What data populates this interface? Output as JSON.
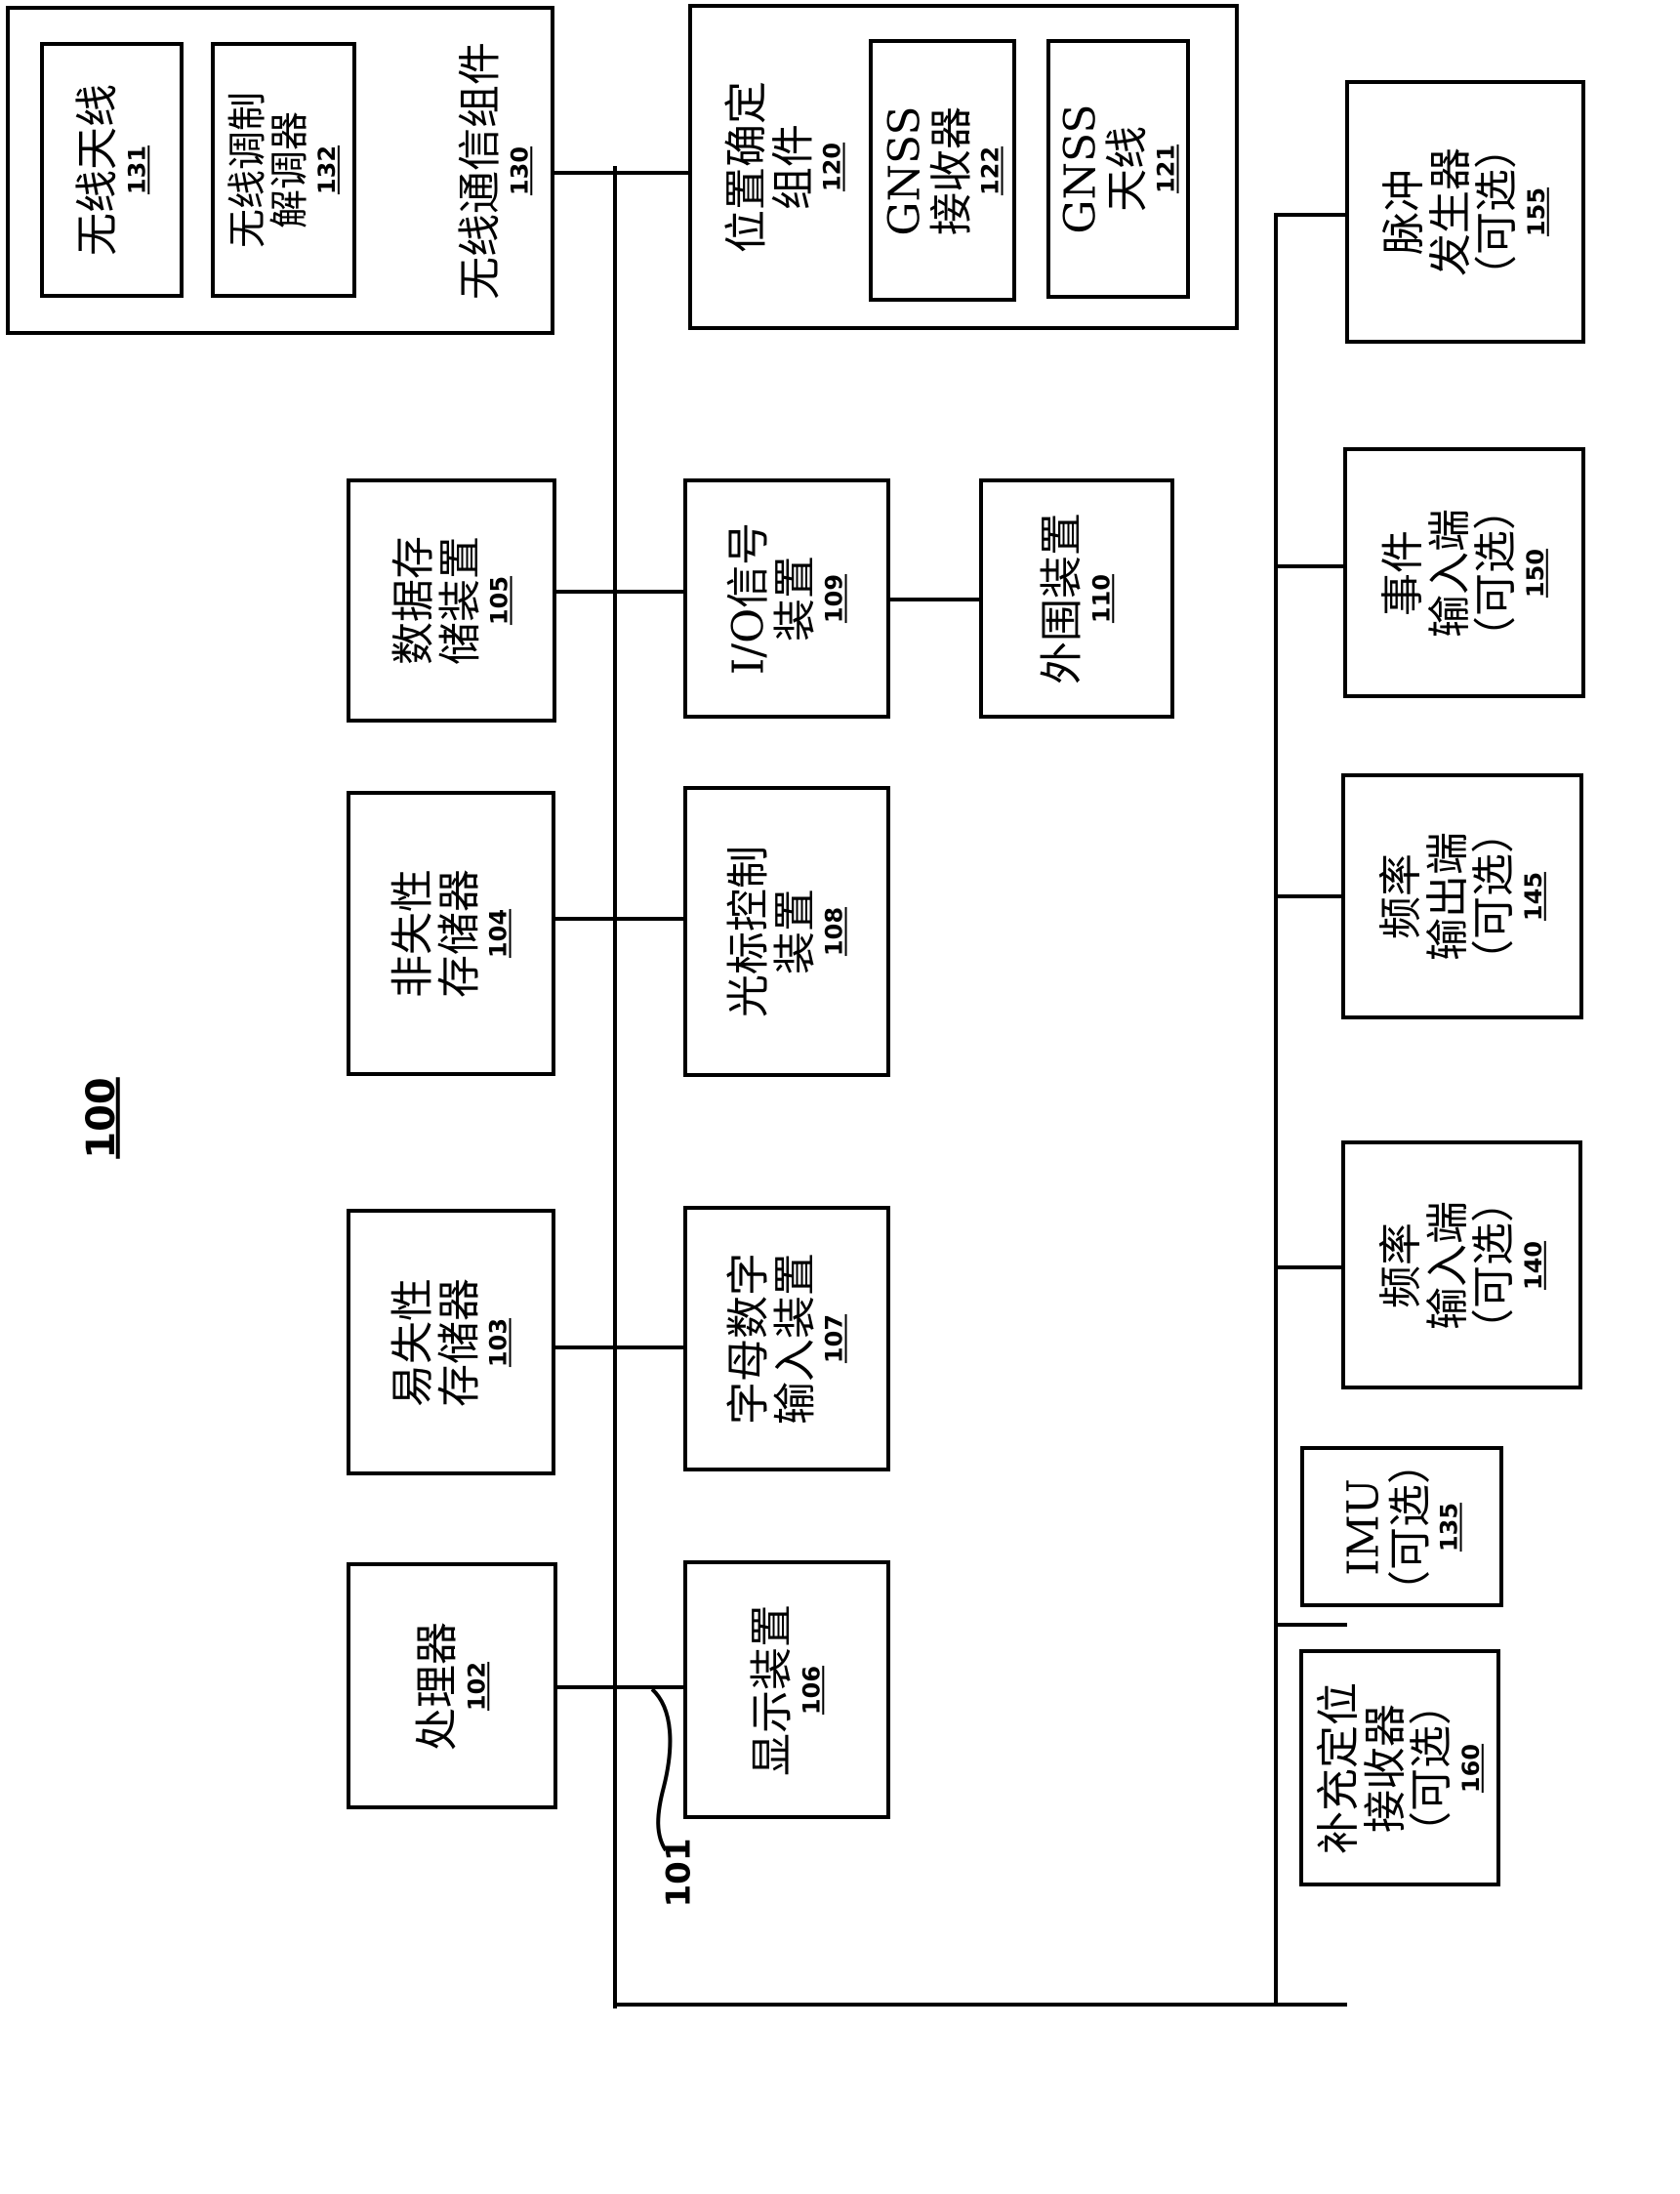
{
  "figure": {
    "number": "100",
    "bus_ref": "101"
  },
  "components": {
    "c130": {
      "label": "无线通信组件",
      "ref": "130"
    },
    "c131": {
      "label": "无线天线",
      "ref": "131"
    },
    "c132": {
      "line1": "无线调制",
      "line2": "解调器",
      "ref": "132"
    },
    "c120": {
      "line1": "位置确定",
      "line2": "组件",
      "ref": "120"
    },
    "c122": {
      "line1": "GNSS",
      "line2": "接收器",
      "ref": "122"
    },
    "c121": {
      "line1": "GNSS",
      "line2": "天线",
      "ref": "121"
    },
    "c105": {
      "line1": "数据存",
      "line2": "储装置",
      "ref": "105"
    },
    "c104": {
      "line1": "非失性",
      "line2": "存储器",
      "ref": "104"
    },
    "c103": {
      "line1": "易失性",
      "line2": "存储器",
      "ref": "103"
    },
    "c102": {
      "label": "处理器",
      "ref": "102"
    },
    "c109": {
      "line1": "I/O信号",
      "line2": "装置",
      "ref": "109"
    },
    "c108": {
      "line1": "光标控制",
      "line2": "装置",
      "ref": "108"
    },
    "c107": {
      "line1": "字母数字",
      "line2": "输入装置",
      "ref": "107"
    },
    "c106": {
      "label": "显示装置",
      "ref": "106"
    },
    "c110": {
      "label": "外围装置",
      "ref": "110"
    },
    "c155": {
      "line1": "脉冲",
      "line2": "发生器",
      "line3": "（可选）",
      "ref": "155"
    },
    "c150": {
      "line1": "事件",
      "line2": "输入端",
      "line3": "（可选）",
      "ref": "150"
    },
    "c145": {
      "line1": "频率",
      "line2": "输出端",
      "line3": "（可选）",
      "ref": "145"
    },
    "c140": {
      "line1": "频率",
      "line2": "输入端",
      "line3": "（可选）",
      "ref": "140"
    },
    "c135": {
      "line1": "IMU",
      "line2": "（可选）",
      "ref": "135"
    },
    "c160": {
      "line1": "补充定位",
      "line2": "接收器",
      "line3": "（可选）",
      "ref": "160"
    }
  }
}
